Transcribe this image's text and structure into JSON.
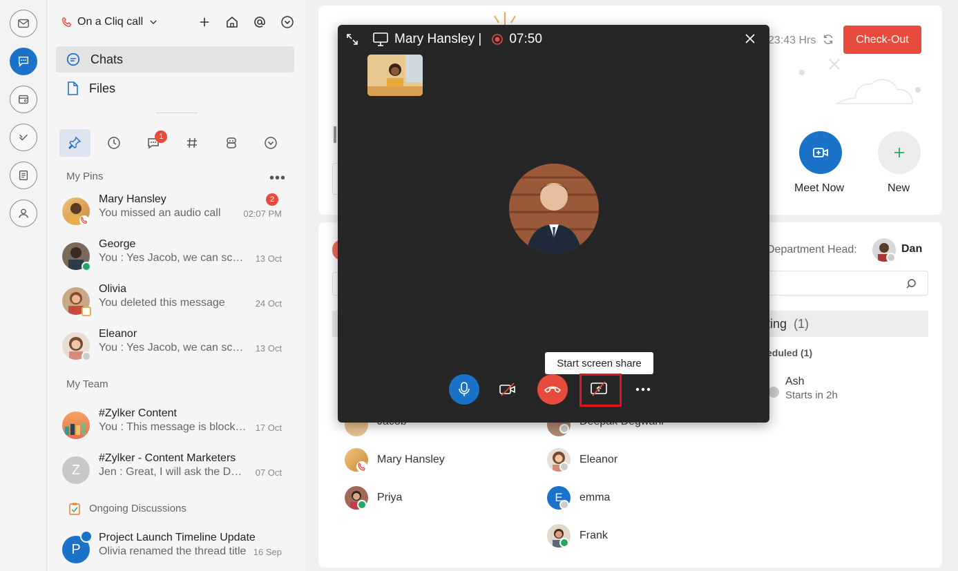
{
  "topbar": {
    "call_status": "On a Cliq call"
  },
  "nav": {
    "chats": "Chats",
    "files": "Files"
  },
  "filters": {
    "unread_badge": "1"
  },
  "pins": {
    "label": "My Pins",
    "items": [
      {
        "name": "Mary Hansley",
        "msg": "You missed an audio call",
        "time": "02:07 PM",
        "badge": "2"
      },
      {
        "name": "George",
        "msg": "You : Yes Jacob, we can schedule",
        "time": "13 Oct"
      },
      {
        "name": "Olivia",
        "msg": "You deleted this message",
        "time": "24 Oct"
      },
      {
        "name": "Eleanor",
        "msg": "You : Yes Jacob, we can schedule",
        "time": "13 Oct"
      }
    ]
  },
  "team": {
    "label": "My Team",
    "items": [
      {
        "name": "#Zylker Content",
        "msg": "You : This message is blocked",
        "time": "17 Oct"
      },
      {
        "name": "#Zylker - Content Marketers",
        "msg": "Jen : Great, I will ask the Design team",
        "time": "07 Oct",
        "initial": "Z"
      }
    ]
  },
  "discussions": {
    "label": "Ongoing Discussions",
    "items": [
      {
        "name": "Project Launch Timeline Update",
        "msg": "Olivia renamed the thread title",
        "time": "16 Sep",
        "initial": "P"
      }
    ]
  },
  "main": {
    "hrs": "23:43 Hrs",
    "checkout": "Check-Out",
    "meet_now": "Meet Now",
    "new": "New",
    "dept_head_label": "Department Head:",
    "dept_head_name": "Dan",
    "meeting_tab": "ting",
    "meeting_count": "(1)",
    "scheduled": "eduled (1)",
    "meeting_host": "Ash",
    "meeting_time": "Starts in 2h",
    "members": [
      "Jacob",
      "Mary  Hansley",
      "Priya",
      "Deepak Degwani",
      "Eleanor",
      "emma",
      "Frank"
    ],
    "emma_initial": "E"
  },
  "call": {
    "title": "Mary Hansley |",
    "timer": "07:50",
    "tooltip": "Start screen share"
  },
  "colors": {
    "accent": "#1a73c9",
    "danger": "#e84b3c",
    "call_bg": "#262626",
    "green": "#20a866"
  }
}
